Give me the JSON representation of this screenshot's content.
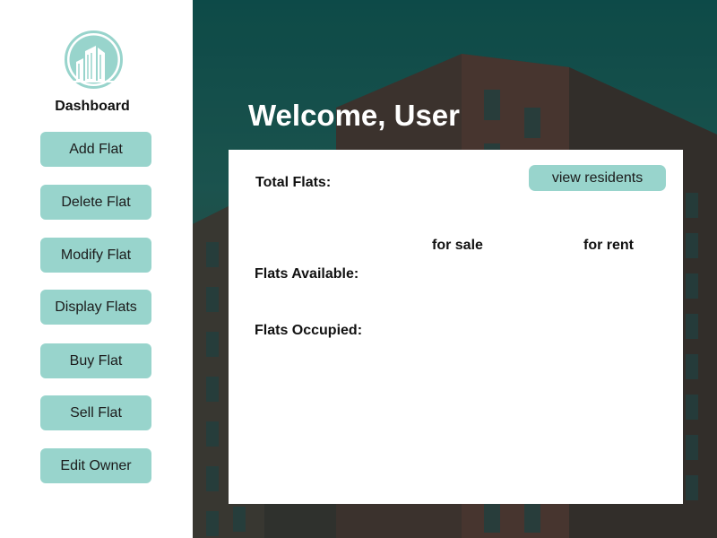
{
  "sidebar": {
    "logo_icon": "buildings-icon",
    "title": "Dashboard",
    "items": [
      {
        "label": "Add Flat"
      },
      {
        "label": "Delete Flat"
      },
      {
        "label": "Modify Flat"
      },
      {
        "label": "Display Flats"
      },
      {
        "label": "Buy Flat"
      },
      {
        "label": "Sell Flat"
      },
      {
        "label": "Edit Owner"
      }
    ]
  },
  "main": {
    "welcome": "Welcome, User",
    "panel": {
      "total_flats_label": "Total Flats:",
      "view_residents_label": "view residents",
      "for_sale_label": "for sale",
      "for_rent_label": "for rent",
      "flats_available_label": "Flats Available:",
      "flats_occupied_label": "Flats Occupied:"
    }
  },
  "colors": {
    "accent": "#98d4cc",
    "hero_top": "#0d4a48",
    "panel": "#ffffff"
  }
}
